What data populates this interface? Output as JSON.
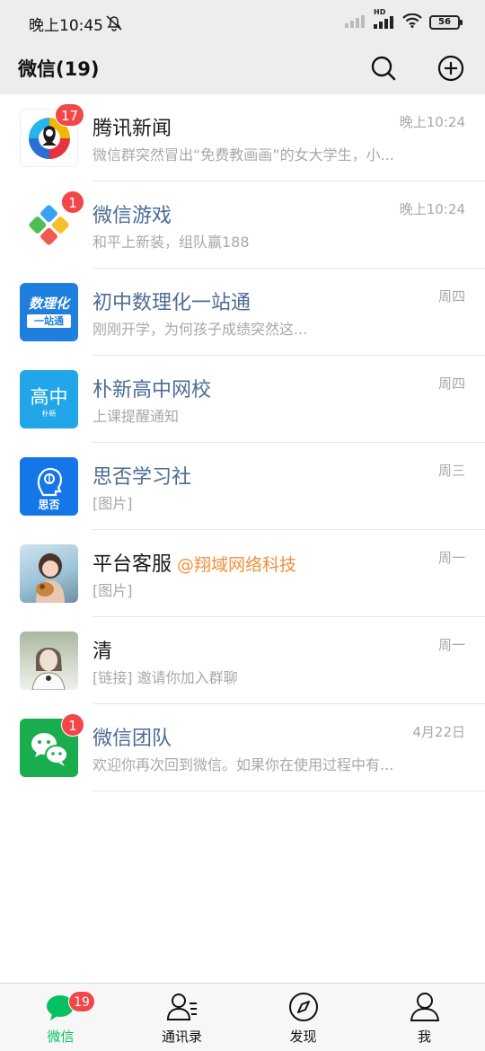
{
  "status_bar": {
    "time": "晚上10:45",
    "network": "HD",
    "battery": "56"
  },
  "header": {
    "title": "微信(19)"
  },
  "chats": [
    {
      "name": "腾讯新闻",
      "preview": "微信群突然冒出“免费教画画”的女大学生，小...",
      "time": "晚上10:24",
      "badge": "17"
    },
    {
      "name": "微信游戏",
      "preview": "和平上新装，组队赢188",
      "time": "晚上10:24",
      "badge": "1"
    },
    {
      "name": "初中数理化一站通",
      "preview": "刚刚开学，为何孩子成绩突然这...",
      "time": "周四",
      "badge": "",
      "avatar_text": [
        "数理化",
        "一站通"
      ]
    },
    {
      "name": "朴新高中网校",
      "preview": "上课提醒通知",
      "time": "周四",
      "badge": "",
      "avatar_text": [
        "高中",
        "朴新"
      ]
    },
    {
      "name": "思否学习社",
      "preview": "[图片]",
      "time": "周三",
      "badge": "",
      "avatar_text": [
        "思否"
      ]
    },
    {
      "name": "平台客服",
      "mention": "@翔域网络科技",
      "preview": "[图片]",
      "time": "周一",
      "badge": ""
    },
    {
      "name": "清",
      "preview": "[链接] 邀请你加入群聊",
      "time": "周一",
      "badge": ""
    },
    {
      "name": "微信团队",
      "preview": "欢迎你再次回到微信。如果你在使用过程中有...",
      "time": "4月22日",
      "badge": "1"
    }
  ],
  "tabs": [
    {
      "label": "微信",
      "badge": "19",
      "active": true
    },
    {
      "label": "通讯录"
    },
    {
      "label": "发现"
    },
    {
      "label": "我"
    }
  ],
  "colors": {
    "accent": "#07c160",
    "badge": "#f2464a",
    "header_bg": "#ededed",
    "mention": "#f0903a",
    "link_name": "#4c6b96"
  }
}
